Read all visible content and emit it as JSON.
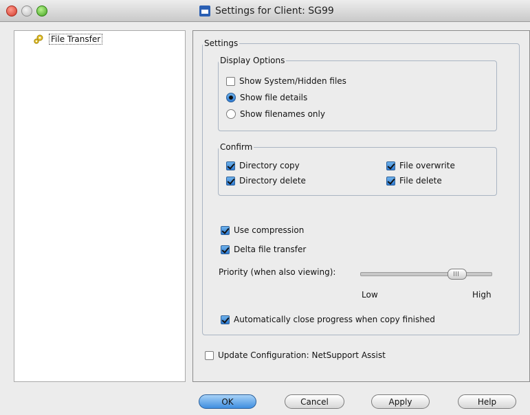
{
  "window": {
    "title": "Settings for Client: SG99"
  },
  "tree": {
    "items": [
      {
        "label": "File Transfer"
      }
    ]
  },
  "settings": {
    "legend": "Settings",
    "display_options": {
      "legend": "Display Options",
      "show_hidden": {
        "label": "Show System/Hidden files",
        "checked": false
      },
      "radio_options": [
        {
          "label": "Show file details",
          "selected": true
        },
        {
          "label": "Show filenames only",
          "selected": false
        }
      ]
    },
    "confirm": {
      "legend": "Confirm",
      "directory_copy": {
        "label": "Directory copy",
        "checked": true
      },
      "directory_delete": {
        "label": "Directory delete",
        "checked": true
      },
      "file_overwrite": {
        "label": "File overwrite",
        "checked": true
      },
      "file_delete": {
        "label": "File delete",
        "checked": true
      }
    },
    "use_compression": {
      "label": "Use compression",
      "checked": true
    },
    "delta_transfer": {
      "label": "Delta file transfer",
      "checked": true
    },
    "priority": {
      "label": "Priority (when also viewing):",
      "low_label": "Low",
      "high_label": "High",
      "value": 0.77
    },
    "auto_close": {
      "label": "Automatically close progress when copy finished",
      "checked": true
    }
  },
  "update_config": {
    "label": "Update Configuration: NetSupport Assist",
    "checked": false
  },
  "buttons": {
    "ok": "OK",
    "cancel": "Cancel",
    "apply": "Apply",
    "help": "Help"
  },
  "colors": {
    "accent": "#3f8ee0",
    "close": "#d0392b",
    "zoom": "#43a21f"
  }
}
